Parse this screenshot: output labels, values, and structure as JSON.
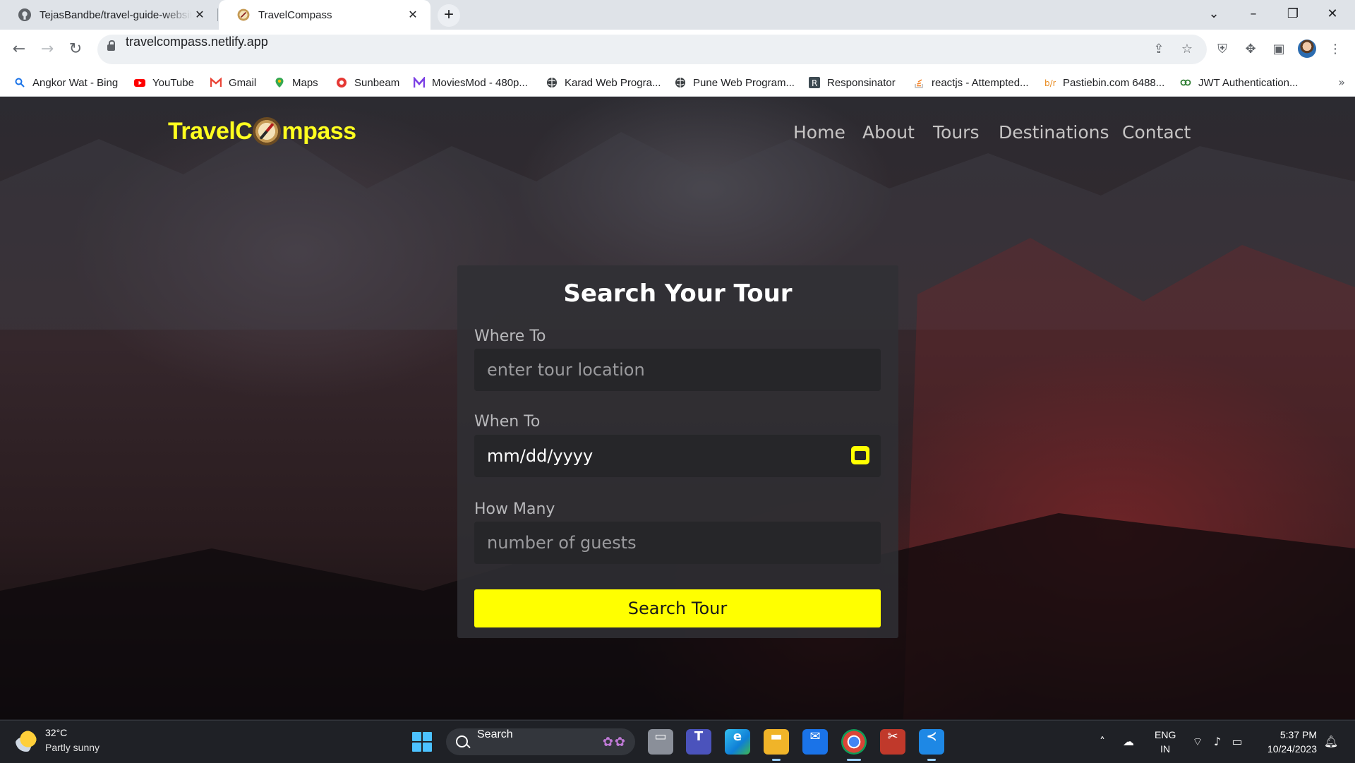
{
  "browser": {
    "tabs": [
      {
        "title": "TejasBandbe/travel-guide-website",
        "active": false,
        "icon": "github-icon"
      },
      {
        "title": "TravelCompass",
        "active": true,
        "icon": "compass-favicon"
      }
    ],
    "url": "travelcompass.netlify.app",
    "bookmarks": [
      {
        "label": "Angkor Wat - Bing",
        "icon": "bing-search-icon"
      },
      {
        "label": "YouTube",
        "icon": "youtube-icon"
      },
      {
        "label": "Gmail",
        "icon": "gmail-icon"
      },
      {
        "label": "Maps",
        "icon": "maps-pin-icon"
      },
      {
        "label": "Sunbeam",
        "icon": "sunbeam-icon"
      },
      {
        "label": "MoviesMod - 480p...",
        "icon": "moviesmod-icon"
      },
      {
        "label": "Karad Web Progra...",
        "icon": "globe-icon"
      },
      {
        "label": "Pune Web Program...",
        "icon": "globe-icon"
      },
      {
        "label": "Responsinator",
        "icon": "responsinator-icon"
      },
      {
        "label": "reactjs - Attempted...",
        "icon": "stackoverflow-icon"
      },
      {
        "label": "Pastiebin.com 6488...",
        "icon": "pastiebin-icon"
      },
      {
        "label": "JWT Authentication...",
        "icon": "jwt-icon"
      }
    ]
  },
  "site": {
    "logo_left": "TravelC",
    "logo_right": "mpass",
    "nav": [
      "Home",
      "About",
      "Tours",
      "Destinations",
      "Contact"
    ],
    "form": {
      "title": "Search Your Tour",
      "where_label": "Where To",
      "where_placeholder": "enter tour location",
      "when_label": "When To",
      "when_value": "mm/dd/yyyy",
      "how_label": "How Many",
      "how_placeholder": "number of guests",
      "button": "Search Tour"
    }
  },
  "taskbar": {
    "temperature": "32°C",
    "condition": "Partly sunny",
    "search_label": "Search",
    "lang_line1": "ENG",
    "lang_line2": "IN",
    "time": "5:37 PM",
    "date": "10/24/2023"
  },
  "colors": {
    "accent_yellow": "#ffff00",
    "logo_yellow": "#ffff1f",
    "card_bg": "#303034",
    "taskbar_bg": "#1f2126"
  }
}
